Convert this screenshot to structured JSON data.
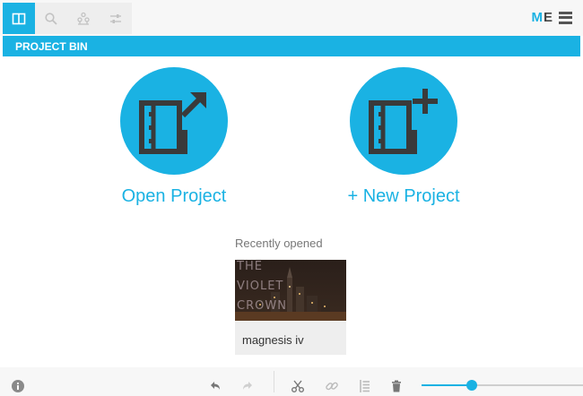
{
  "toolbar": {
    "tools": [
      {
        "icon": "project-bin-icon",
        "active": true
      },
      {
        "icon": "search-icon",
        "active": false
      },
      {
        "icon": "effects-icon",
        "active": false
      },
      {
        "icon": "sliders-icon",
        "active": false
      }
    ]
  },
  "brand": {
    "first": "M",
    "second": "E"
  },
  "panel": {
    "title": "PROJECT BIN"
  },
  "actions": {
    "open": {
      "label": "Open Project",
      "icon": "open-project-icon"
    },
    "new": {
      "label": "+ New Project",
      "icon": "new-project-icon"
    }
  },
  "recent": {
    "title": "Recently opened",
    "items": [
      {
        "name": "magnesis iv",
        "thumbnail_lines": [
          "THE",
          "VIOLET",
          "CROWN"
        ]
      }
    ]
  },
  "bottombar": {
    "icons": [
      "info-icon",
      "undo-icon",
      "redo-icon",
      "scissors-icon",
      "link-icon",
      "properties-icon",
      "trash-icon"
    ],
    "zoom_fraction": 0.31
  },
  "colors": {
    "accent": "#1ab2e3",
    "topbar": "#f7f7f7",
    "card": "#eeeeee"
  }
}
